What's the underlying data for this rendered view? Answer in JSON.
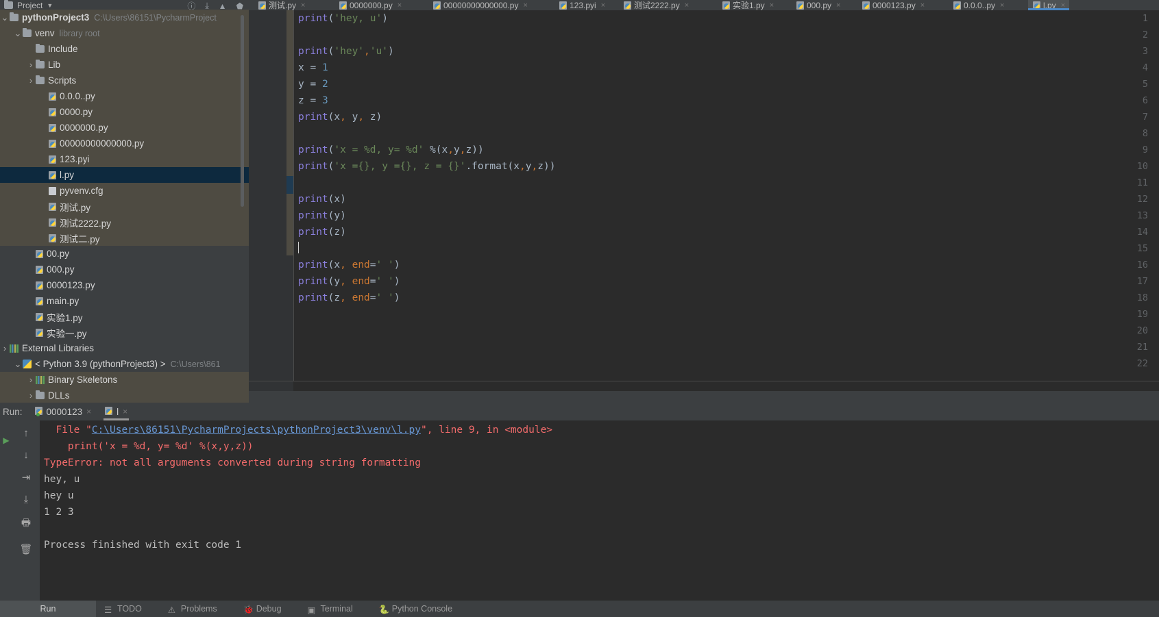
{
  "window": {
    "project_panel_title": "Project",
    "project_name": "pythonProject3",
    "project_path": "C:\\Users\\86151\\PycharmProject"
  },
  "editor_tabs": [
    {
      "label": "测试.py",
      "icon": "python-file-icon",
      "active": false
    },
    {
      "label": "0000000.py",
      "icon": "python-file-icon",
      "active": false
    },
    {
      "label": "00000000000000.py",
      "icon": "python-file-icon",
      "active": false
    },
    {
      "label": "123.pyi",
      "icon": "python-file-icon",
      "active": false
    },
    {
      "label": "测试2222.py",
      "icon": "python-file-icon",
      "active": false
    },
    {
      "label": "实验1.py",
      "icon": "python-file-icon",
      "active": false
    },
    {
      "label": "000.py",
      "icon": "python-file-icon",
      "active": false
    },
    {
      "label": "0000123.py",
      "icon": "python-file-icon",
      "active": false
    },
    {
      "label": "0.0.0..py",
      "icon": "python-file-icon",
      "active": false
    },
    {
      "label": "l.py",
      "icon": "python-file-icon",
      "active": true
    }
  ],
  "project_tree": [
    {
      "label": "pythonProject3",
      "sub": "C:\\Users\\86151\\PycharmProject",
      "indent": 0,
      "arrow": "down",
      "icon": "folder-icon",
      "bold": true,
      "state": "shaded"
    },
    {
      "label": "venv",
      "sub": "library root",
      "indent": 1,
      "arrow": "down",
      "icon": "folder-icon",
      "bold": false,
      "state": "shaded"
    },
    {
      "label": "Include",
      "sub": "",
      "indent": 2,
      "arrow": "",
      "icon": "folder-icon",
      "bold": false,
      "state": "shaded"
    },
    {
      "label": "Lib",
      "sub": "",
      "indent": 2,
      "arrow": "right",
      "icon": "folder-icon",
      "bold": false,
      "state": "shaded"
    },
    {
      "label": "Scripts",
      "sub": "",
      "indent": 2,
      "arrow": "right",
      "icon": "folder-icon",
      "bold": false,
      "state": "shaded"
    },
    {
      "label": "0.0.0..py",
      "sub": "",
      "indent": 3,
      "arrow": "",
      "icon": "python-file-icon",
      "bold": false,
      "state": "shaded"
    },
    {
      "label": "0000.py",
      "sub": "",
      "indent": 3,
      "arrow": "",
      "icon": "python-file-icon",
      "bold": false,
      "state": "shaded"
    },
    {
      "label": "0000000.py",
      "sub": "",
      "indent": 3,
      "arrow": "",
      "icon": "python-file-icon",
      "bold": false,
      "state": "shaded"
    },
    {
      "label": "00000000000000.py",
      "sub": "",
      "indent": 3,
      "arrow": "",
      "icon": "python-file-icon",
      "bold": false,
      "state": "shaded"
    },
    {
      "label": "123.pyi",
      "sub": "",
      "indent": 3,
      "arrow": "",
      "icon": "python-file-icon",
      "bold": false,
      "state": "shaded"
    },
    {
      "label": "l.py",
      "sub": "",
      "indent": 3,
      "arrow": "",
      "icon": "python-file-icon",
      "bold": false,
      "state": "selected"
    },
    {
      "label": "pyvenv.cfg",
      "sub": "",
      "indent": 3,
      "arrow": "",
      "icon": "config-file-icon",
      "bold": false,
      "state": "shaded"
    },
    {
      "label": "测试.py",
      "sub": "",
      "indent": 3,
      "arrow": "",
      "icon": "python-file-icon",
      "bold": false,
      "state": "shaded"
    },
    {
      "label": "测试2222.py",
      "sub": "",
      "indent": 3,
      "arrow": "",
      "icon": "python-file-icon",
      "bold": false,
      "state": "shaded"
    },
    {
      "label": "测试二.py",
      "sub": "",
      "indent": 3,
      "arrow": "",
      "icon": "python-file-icon",
      "bold": false,
      "state": "shaded"
    },
    {
      "label": "00.py",
      "sub": "",
      "indent": 2,
      "arrow": "",
      "icon": "python-file-icon",
      "bold": false,
      "state": "normal"
    },
    {
      "label": "000.py",
      "sub": "",
      "indent": 2,
      "arrow": "",
      "icon": "python-file-icon",
      "bold": false,
      "state": "normal"
    },
    {
      "label": "0000123.py",
      "sub": "",
      "indent": 2,
      "arrow": "",
      "icon": "python-file-icon",
      "bold": false,
      "state": "normal"
    },
    {
      "label": "main.py",
      "sub": "",
      "indent": 2,
      "arrow": "",
      "icon": "python-file-icon",
      "bold": false,
      "state": "normal"
    },
    {
      "label": "实验1.py",
      "sub": "",
      "indent": 2,
      "arrow": "",
      "icon": "python-file-icon",
      "bold": false,
      "state": "normal"
    },
    {
      "label": "实验一.py",
      "sub": "",
      "indent": 2,
      "arrow": "",
      "icon": "python-file-icon",
      "bold": false,
      "state": "normal"
    },
    {
      "label": "External Libraries",
      "sub": "",
      "indent": 0,
      "arrow": "right",
      "icon": "library-icon",
      "bold": false,
      "state": "normal"
    },
    {
      "label": "< Python 3.9 (pythonProject3) >",
      "sub": "C:\\Users\\861",
      "indent": 1,
      "arrow": "down",
      "icon": "python-logo-icon",
      "bold": false,
      "state": "normal"
    },
    {
      "label": "Binary Skeletons",
      "sub": "",
      "indent": 2,
      "arrow": "right",
      "icon": "library-icon",
      "bold": false,
      "state": "shaded"
    },
    {
      "label": "DLLs",
      "sub": "",
      "indent": 2,
      "arrow": "right",
      "icon": "folder-icon",
      "bold": false,
      "state": "shaded"
    }
  ],
  "code_lines": [
    {
      "n": "1",
      "tokens": [
        {
          "t": "print",
          "c": "fn"
        },
        {
          "t": "(",
          "c": "punct"
        },
        {
          "t": "'hey, u'",
          "c": "str"
        },
        {
          "t": ")",
          "c": "punct"
        }
      ]
    },
    {
      "n": "2",
      "tokens": []
    },
    {
      "n": "3",
      "tokens": [
        {
          "t": "print",
          "c": "fn"
        },
        {
          "t": "(",
          "c": "punct"
        },
        {
          "t": "'hey'",
          "c": "str"
        },
        {
          "t": ",",
          "c": "comma"
        },
        {
          "t": "'u'",
          "c": "str"
        },
        {
          "t": ")",
          "c": "punct"
        }
      ]
    },
    {
      "n": "4",
      "tokens": [
        {
          "t": "x ",
          "c": "op"
        },
        {
          "t": "= ",
          "c": "op"
        },
        {
          "t": "1",
          "c": "num"
        }
      ]
    },
    {
      "n": "5",
      "tokens": [
        {
          "t": "y ",
          "c": "op"
        },
        {
          "t": "= ",
          "c": "op"
        },
        {
          "t": "2",
          "c": "num"
        }
      ]
    },
    {
      "n": "6",
      "tokens": [
        {
          "t": "z ",
          "c": "op"
        },
        {
          "t": "= ",
          "c": "op"
        },
        {
          "t": "3",
          "c": "num"
        }
      ]
    },
    {
      "n": "7",
      "tokens": [
        {
          "t": "print",
          "c": "fn"
        },
        {
          "t": "(",
          "c": "punct"
        },
        {
          "t": "x",
          "c": "op"
        },
        {
          "t": ",",
          "c": "comma"
        },
        {
          "t": " y",
          "c": "op"
        },
        {
          "t": ",",
          "c": "comma"
        },
        {
          "t": " z",
          "c": "op"
        },
        {
          "t": ")",
          "c": "punct"
        }
      ]
    },
    {
      "n": "8",
      "tokens": []
    },
    {
      "n": "9",
      "tokens": [
        {
          "t": "print",
          "c": "fn"
        },
        {
          "t": "(",
          "c": "punct"
        },
        {
          "t": "'x = %d, y= %d'",
          "c": "str"
        },
        {
          "t": " %(",
          "c": "punct"
        },
        {
          "t": "x",
          "c": "op"
        },
        {
          "t": ",",
          "c": "comma"
        },
        {
          "t": "y",
          "c": "op"
        },
        {
          "t": ",",
          "c": "comma"
        },
        {
          "t": "z",
          "c": "op"
        },
        {
          "t": "))",
          "c": "punct"
        }
      ]
    },
    {
      "n": "10",
      "tokens": [
        {
          "t": "print",
          "c": "fn"
        },
        {
          "t": "(",
          "c": "punct"
        },
        {
          "t": "'x ={}, y ={}, z = {}'",
          "c": "str"
        },
        {
          "t": ".format(",
          "c": "punct"
        },
        {
          "t": "x",
          "c": "op"
        },
        {
          "t": ",",
          "c": "comma"
        },
        {
          "t": "y",
          "c": "op"
        },
        {
          "t": ",",
          "c": "comma"
        },
        {
          "t": "z",
          "c": "op"
        },
        {
          "t": "))",
          "c": "punct"
        }
      ]
    },
    {
      "n": "11",
      "tokens": []
    },
    {
      "n": "12",
      "tokens": [
        {
          "t": "print",
          "c": "fn"
        },
        {
          "t": "(",
          "c": "punct"
        },
        {
          "t": "x",
          "c": "op"
        },
        {
          "t": ")",
          "c": "punct"
        }
      ]
    },
    {
      "n": "13",
      "tokens": [
        {
          "t": "print",
          "c": "fn"
        },
        {
          "t": "(",
          "c": "punct"
        },
        {
          "t": "y",
          "c": "op"
        },
        {
          "t": ")",
          "c": "punct"
        }
      ]
    },
    {
      "n": "14",
      "tokens": [
        {
          "t": "print",
          "c": "fn"
        },
        {
          "t": "(",
          "c": "punct"
        },
        {
          "t": "z",
          "c": "op"
        },
        {
          "t": ")",
          "c": "punct"
        }
      ]
    },
    {
      "n": "15",
      "tokens": [],
      "caret": true
    },
    {
      "n": "16",
      "tokens": [
        {
          "t": "print",
          "c": "fn"
        },
        {
          "t": "(",
          "c": "punct"
        },
        {
          "t": "x",
          "c": "op"
        },
        {
          "t": ",",
          "c": "comma"
        },
        {
          "t": " ",
          "c": "op"
        },
        {
          "t": "end",
          "c": "kw"
        },
        {
          "t": "=",
          "c": "op"
        },
        {
          "t": "' '",
          "c": "str"
        },
        {
          "t": ")",
          "c": "punct"
        }
      ]
    },
    {
      "n": "17",
      "tokens": [
        {
          "t": "print",
          "c": "fn"
        },
        {
          "t": "(",
          "c": "punct"
        },
        {
          "t": "y",
          "c": "op"
        },
        {
          "t": ",",
          "c": "comma"
        },
        {
          "t": " ",
          "c": "op"
        },
        {
          "t": "end",
          "c": "kw"
        },
        {
          "t": "=",
          "c": "op"
        },
        {
          "t": "' '",
          "c": "str"
        },
        {
          "t": ")",
          "c": "punct"
        }
      ]
    },
    {
      "n": "18",
      "tokens": [
        {
          "t": "print",
          "c": "fn"
        },
        {
          "t": "(",
          "c": "punct"
        },
        {
          "t": "z",
          "c": "op"
        },
        {
          "t": ",",
          "c": "comma"
        },
        {
          "t": " ",
          "c": "op"
        },
        {
          "t": "end",
          "c": "kw"
        },
        {
          "t": "=",
          "c": "op"
        },
        {
          "t": "' '",
          "c": "str"
        },
        {
          "t": ")",
          "c": "punct"
        }
      ]
    },
    {
      "n": "19",
      "tokens": []
    },
    {
      "n": "20",
      "tokens": []
    },
    {
      "n": "21",
      "tokens": []
    },
    {
      "n": "22",
      "tokens": []
    }
  ],
  "run_panel": {
    "label": "Run:",
    "tabs": [
      {
        "label": "0000123",
        "active": false,
        "has_status_dot": true
      },
      {
        "label": "l",
        "active": true,
        "has_status_dot": false
      }
    ],
    "console_lines": [
      {
        "kind": "traceback-file",
        "prefix": "  File ",
        "link": "C:\\Users\\86151\\PycharmProjects\\pythonProject3\\venv\\l.py",
        "suffix": ", line 9, in <module>"
      },
      {
        "kind": "error",
        "text": "    print('x = %d, y= %d' %(x,y,z))"
      },
      {
        "kind": "error",
        "text": "TypeError: not all arguments converted during string formatting"
      },
      {
        "kind": "out",
        "text": "hey, u"
      },
      {
        "kind": "out",
        "text": "hey u"
      },
      {
        "kind": "out",
        "text": "1 2 3"
      },
      {
        "kind": "out",
        "text": ""
      },
      {
        "kind": "out",
        "text": "Process finished with exit code 1"
      }
    ],
    "side_buttons": [
      {
        "name": "rerun-button",
        "glyph": "▶"
      },
      {
        "name": "scroll-up-button",
        "glyph": "↑"
      },
      {
        "name": "scroll-down-button",
        "glyph": "↓"
      },
      {
        "name": "soft-wrap-button",
        "glyph": "⇥"
      },
      {
        "name": "scroll-to-end-button",
        "glyph": "⤓"
      },
      {
        "name": "print-button",
        "glyph": "🖶"
      },
      {
        "name": "clear-all-button",
        "glyph": "🗑"
      }
    ]
  },
  "status_bar": {
    "run_label": "Run",
    "items": [
      {
        "label": "TODO",
        "icon": "todo-icon"
      },
      {
        "label": "Problems",
        "icon": "problems-icon"
      },
      {
        "label": "Debug",
        "icon": "debug-icon"
      },
      {
        "label": "Terminal",
        "icon": "terminal-icon"
      },
      {
        "label": "Python Console",
        "icon": "python-console-icon"
      }
    ]
  },
  "colors": {
    "editor_bg": "#2b2b2b",
    "panel_bg": "#3c3f41",
    "selection_blue": "#0d293e",
    "string_green": "#6a8759",
    "keyword_orange": "#cc7832",
    "number_blue": "#6897bb",
    "error_red": "#f26b6b",
    "link_blue": "#6897d4"
  }
}
